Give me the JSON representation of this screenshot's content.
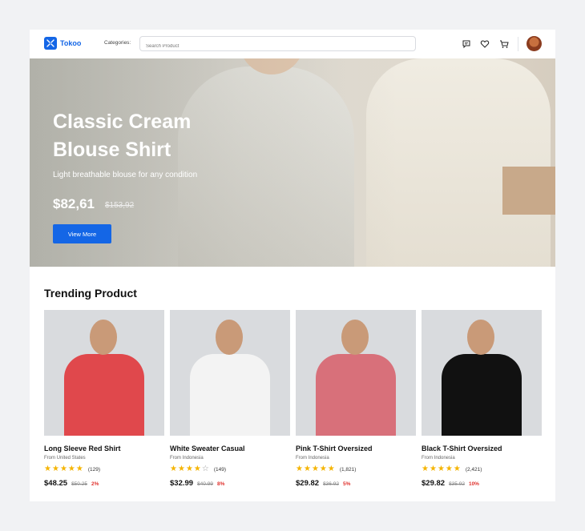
{
  "nav": {
    "brand": "Tokoo",
    "categories_label": "Categories:",
    "search_placeholder": "Search Product"
  },
  "hero": {
    "title_line1": "Classic Cream",
    "title_line2": "Blouse Shirt",
    "subtitle": "Light breathable blouse for any condition",
    "price": "$82,61",
    "old_price": "$153,92",
    "button": "View More"
  },
  "trending": {
    "title": "Trending Product",
    "products": [
      {
        "name": "Long Sleeve Red Shirt",
        "from": "From United States",
        "rating": 5,
        "count": "(129)",
        "price": "$48.25",
        "old": "$50.25",
        "discount": "2%",
        "color": "#e0484c"
      },
      {
        "name": "White Sweater Casual",
        "from": "From Indonesia",
        "rating": 4,
        "count": "(149)",
        "price": "$32.99",
        "old": "$40.99",
        "discount": "8%",
        "color": "#f3f3f3"
      },
      {
        "name": "Pink T-Shirt Oversized",
        "from": "From Indonesia",
        "rating": 5,
        "count": "(1,821)",
        "price": "$29.82",
        "old": "$36.92",
        "discount": "5%",
        "color": "#d8707a"
      },
      {
        "name": "Black T-Shirt Oversized",
        "from": "From Indonesia",
        "rating": 5,
        "count": "(2,421)",
        "price": "$29.82",
        "old": "$35.92",
        "discount": "10%",
        "color": "#111111"
      }
    ]
  },
  "colors": {
    "accent": "#1466e6",
    "star": "#f5b400",
    "discount": "#e0332f"
  }
}
